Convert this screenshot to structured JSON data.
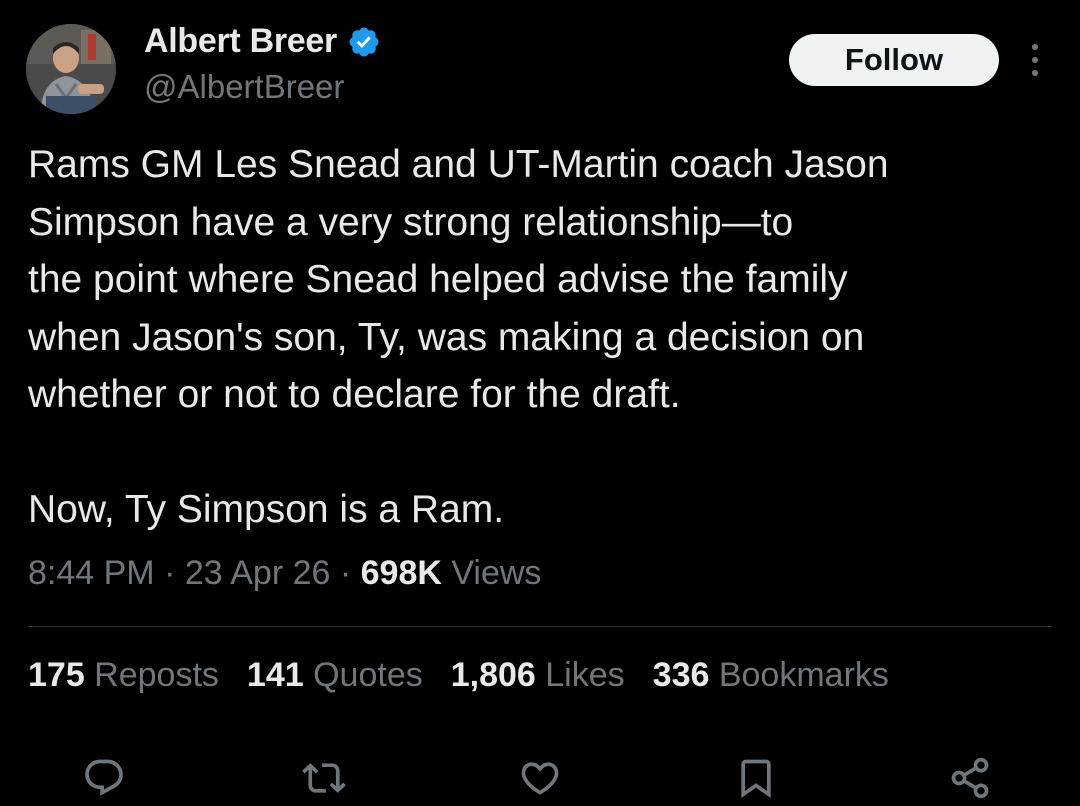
{
  "author": {
    "display_name": "Albert Breer",
    "handle": "@AlbertBreer",
    "verified": true,
    "verified_color": "#1d9bf0"
  },
  "follow_label": "Follow",
  "tweet": {
    "lines": [
      "Rams GM Les Snead and UT-Martin coach Jason",
      "Simpson have a very strong relationship—to",
      "the point where Snead helped advise the family",
      "when Jason's son, Ty, was making a decision on",
      "whether or not to declare for the draft.",
      "Now, Ty Simpson is a Ram."
    ]
  },
  "meta": {
    "time": "8:44 PM",
    "separator": " · ",
    "date": "23 Apr 26",
    "views_count": "698K",
    "views_label": " Views"
  },
  "stats": {
    "reposts": {
      "count": "175",
      "label": " Reposts"
    },
    "quotes": {
      "count": "141",
      "label": " Quotes"
    },
    "likes": {
      "count": "1,806",
      "label": " Likes"
    },
    "bookmarks": {
      "count": "336",
      "label": " Bookmarks"
    }
  },
  "actions": [
    "reply-icon",
    "repost-icon",
    "like-icon",
    "bookmark-icon",
    "share-icon"
  ],
  "colors": {
    "background": "#000000",
    "text": "#e7e9ea",
    "secondary": "#71767b",
    "divider": "#2f3336",
    "follow_bg": "#eff3f4"
  }
}
